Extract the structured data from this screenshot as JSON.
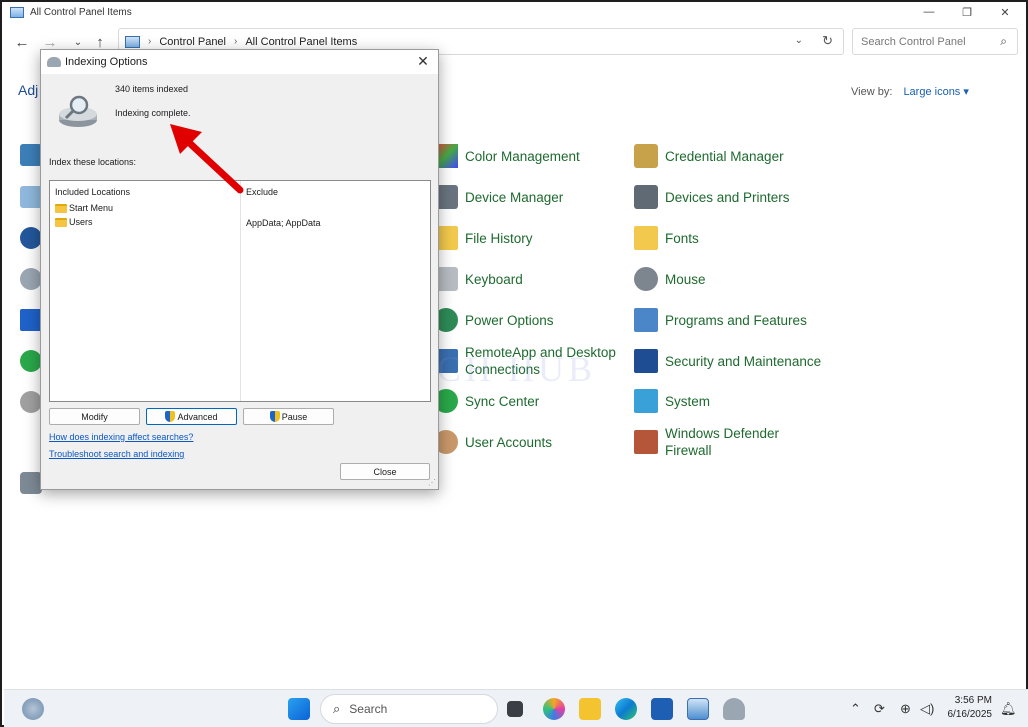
{
  "window": {
    "title": "All Control Panel Items",
    "controls": {
      "minimize": "—",
      "maximize": "❐",
      "close": "✕"
    }
  },
  "address": {
    "crumbs": [
      "Control Panel",
      "All Control Panel Items"
    ],
    "search_placeholder": "Search Control Panel"
  },
  "header": {
    "adjust_text": "Adj",
    "view_by_label": "View by:",
    "view_by_value": "Large icons"
  },
  "items": [
    {
      "label": "Color Management",
      "icon": "color-management-icon"
    },
    {
      "label": "Credential Manager",
      "icon": "credential-manager-icon"
    },
    {
      "label": "Device Manager",
      "icon": "device-manager-icon"
    },
    {
      "label": "Devices and Printers",
      "icon": "devices-printers-icon"
    },
    {
      "label": "File History",
      "icon": "file-history-icon"
    },
    {
      "label": "Fonts",
      "icon": "fonts-icon"
    },
    {
      "label": "Keyboard",
      "icon": "keyboard-icon"
    },
    {
      "label": "Mouse",
      "icon": "mouse-icon"
    },
    {
      "label": "Power Options",
      "icon": "power-options-icon"
    },
    {
      "label": "Programs and Features",
      "icon": "programs-features-icon"
    },
    {
      "label": "RemoteApp and Desktop\nConnections",
      "icon": "remoteapp-icon"
    },
    {
      "label": "Security and Maintenance",
      "icon": "security-maintenance-icon"
    },
    {
      "label": "Sync Center",
      "icon": "sync-center-icon"
    },
    {
      "label": "System",
      "icon": "system-icon"
    },
    {
      "label": "User Accounts",
      "icon": "user-accounts-icon"
    },
    {
      "label": "Windows Defender\nFirewall",
      "icon": "firewall-icon"
    }
  ],
  "watermark": "ITECH HUB",
  "dialog": {
    "title": "Indexing Options",
    "items_indexed": "340 items indexed",
    "status": "Indexing complete.",
    "index_label": "Index these locations:",
    "col_included": "Included Locations",
    "col_exclude": "Exclude",
    "locations": [
      {
        "name": "Start Menu",
        "exclude": ""
      },
      {
        "name": "Users",
        "exclude": "AppData; AppData"
      }
    ],
    "buttons": {
      "modify": "Modify",
      "advanced": "Advanced",
      "pause": "Pause",
      "close": "Close"
    },
    "links": {
      "affect": "How does indexing affect searches?",
      "troubleshoot": "Troubleshoot search and indexing"
    }
  },
  "taskbar": {
    "search_label": "Search",
    "time": "3:56 PM",
    "date": "6/16/2025"
  },
  "colors": {
    "accent": "#0067c0",
    "link_green": "#1e6a2f",
    "arrow_red": "#e00000"
  }
}
